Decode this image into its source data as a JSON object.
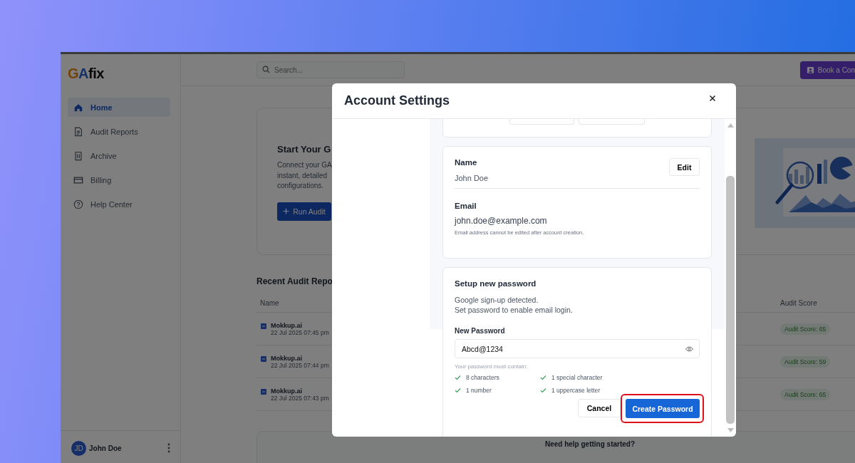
{
  "logo": {
    "mark": "GA",
    "text": "fix"
  },
  "sidebar": {
    "items": [
      {
        "label": "Home",
        "selected": true
      },
      {
        "label": "Audit Reports",
        "selected": false
      },
      {
        "label": "Archive",
        "selected": false
      },
      {
        "label": "Billing",
        "selected": false
      },
      {
        "label": "Help Center",
        "selected": false
      }
    ],
    "user": {
      "initials": "JD",
      "name": "John Doe"
    }
  },
  "topbar": {
    "search": {
      "placeholder": "Search..."
    },
    "book_button": "Book a Con"
  },
  "hero": {
    "title": "Start Your G",
    "description_lines": [
      "Connect your GA",
      "instant, detailed",
      "configurations."
    ],
    "run_button": "Run Audit"
  },
  "recent": {
    "title": "Recent Audit Repo",
    "columns": [
      "Name",
      "Audit Score"
    ],
    "rows": [
      {
        "name": "Mokkup.ai",
        "date": "22 Jul 2025 07:45 pm",
        "score": "Audit Score: 65"
      },
      {
        "name": "Mokkup.ai",
        "date": "22 Jul 2025 07:44 pm",
        "score": "Audit Score: 59"
      },
      {
        "name": "Mokkup.ai",
        "date": "22 Jul 2025 07:43 pm",
        "score": "Audit Score: 65"
      }
    ]
  },
  "help": {
    "title": "Need help getting started?"
  },
  "modal": {
    "title": "Account Settings",
    "name": {
      "label": "Name",
      "value": "John Doe",
      "edit_button": "Edit"
    },
    "email": {
      "label": "Email",
      "value": "john.doe@example.com",
      "note": "Email address cannot be edited after account creation."
    },
    "password": {
      "title": "Setup new password",
      "description_lines": [
        "Google sign-up detected.",
        "Set password to enable email login."
      ],
      "field_label": "New Password",
      "value": "Abcd@1234",
      "hint": "Your password must contain:",
      "requirements": [
        {
          "label": "8 characters",
          "met": true
        },
        {
          "label": "1 special character",
          "met": true
        },
        {
          "label": "1 number",
          "met": true
        },
        {
          "label": "1 uppercase letter",
          "met": true
        }
      ],
      "cancel_button": "Cancel",
      "create_button": "Create Password",
      "create_highlighted": true
    }
  }
}
